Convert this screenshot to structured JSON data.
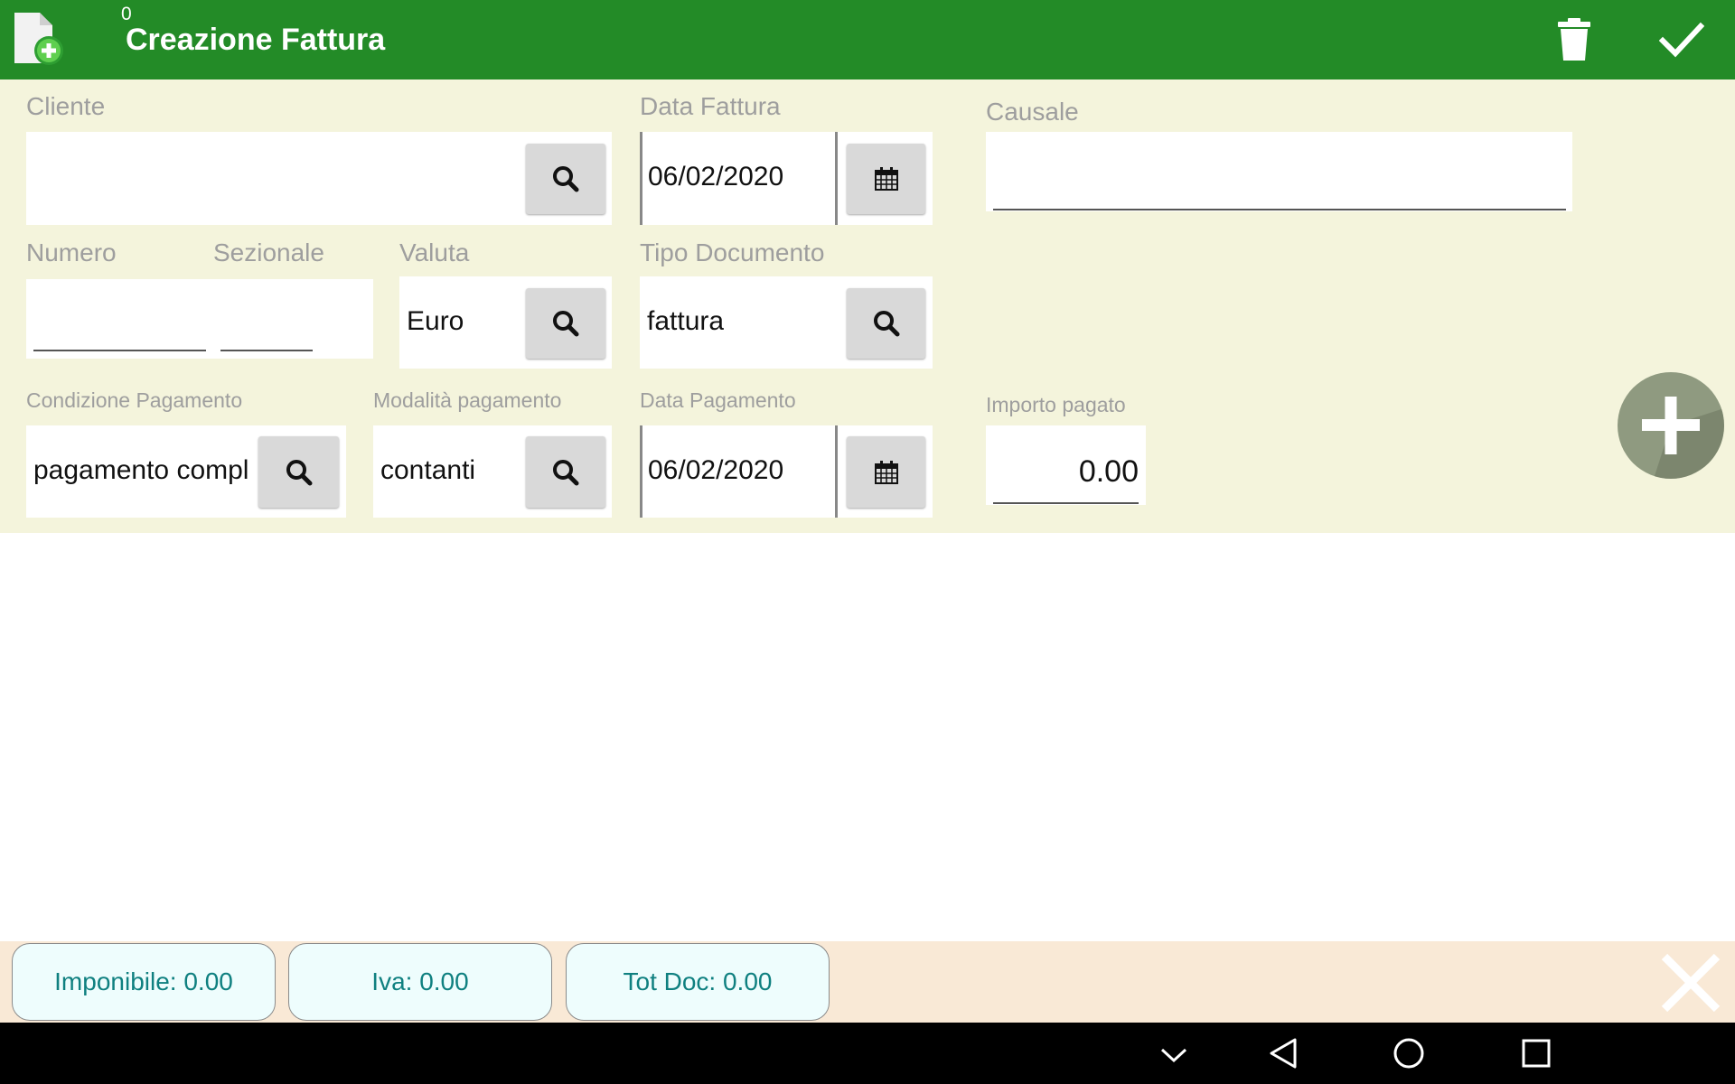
{
  "header": {
    "counter": "0",
    "title": "Creazione Fattura",
    "app_icon": "new-document-icon",
    "delete_icon": "trash-icon",
    "confirm_icon": "checkmark-icon",
    "bar_color": "#238b27"
  },
  "form": {
    "cliente": {
      "label": "Cliente",
      "value": ""
    },
    "data_fattura": {
      "label": "Data Fattura",
      "value": "06/02/2020"
    },
    "causale": {
      "label": "Causale",
      "value": ""
    },
    "numero": {
      "label": "Numero",
      "value": ""
    },
    "sezionale": {
      "label": "Sezionale",
      "value": ""
    },
    "valuta": {
      "label": "Valuta",
      "value": "Euro"
    },
    "tipo_documento": {
      "label": "Tipo Documento",
      "value": "fattura"
    },
    "condizione_pagamento": {
      "label": "Condizione Pagamento",
      "value": "pagamento compl"
    },
    "modalita_pagamento": {
      "label": "Modalità pagamento",
      "value": "contanti"
    },
    "data_pagamento": {
      "label": "Data Pagamento",
      "value": "06/02/2020"
    },
    "importo_pagato": {
      "label": "Importo pagato",
      "value": "0.00"
    },
    "background_color": "#f4f4dc"
  },
  "fab": {
    "icon": "plus-icon"
  },
  "totals": {
    "imponibile": "Imponibile: 0.00",
    "iva": "Iva: 0.00",
    "tot_doc": "Tot Doc: 0.00",
    "text_color": "#0f8080",
    "close_icon": "close-x-icon"
  },
  "navbar": {
    "icons": [
      "chevron-down-icon",
      "back-icon",
      "home-icon",
      "recents-icon"
    ]
  }
}
